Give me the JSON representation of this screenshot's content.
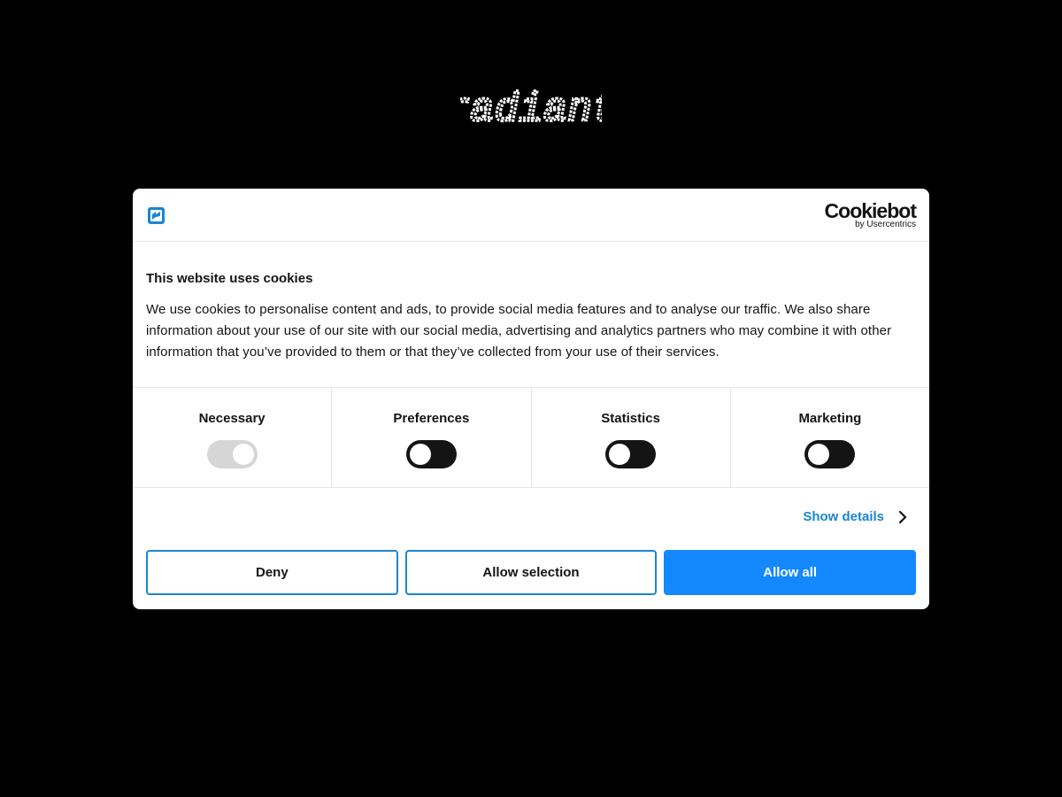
{
  "brand": {
    "logo_text": "radiant"
  },
  "dialog": {
    "provider": {
      "name": "Cookiebot",
      "byline": "by Usercentrics"
    },
    "title": "This website uses cookies",
    "text": "We use cookies to personalise content and ads, to provide social media features and to analyse our traffic. We also share information about your use of our site with our social media, advertising and analytics partners who may combine it with other information that you’ve provided to them or that they’ve collected from your use of their services.",
    "categories": [
      {
        "label": "Necessary",
        "enabled": true,
        "locked": true
      },
      {
        "label": "Preferences",
        "enabled": false,
        "locked": false
      },
      {
        "label": "Statistics",
        "enabled": false,
        "locked": false
      },
      {
        "label": "Marketing",
        "enabled": false,
        "locked": false
      }
    ],
    "show_details": "Show details",
    "buttons": {
      "deny": "Deny",
      "allow_selection": "Allow selection",
      "allow_all": "Allow all"
    }
  },
  "colors": {
    "background": "#000000",
    "accent": "#1389fd",
    "link": "#1a86d0",
    "toggle_off": "#141414",
    "toggle_locked": "#d6d6d6"
  },
  "icons": {
    "site": "site-logo-icon",
    "details": "chevron-right-icon"
  }
}
